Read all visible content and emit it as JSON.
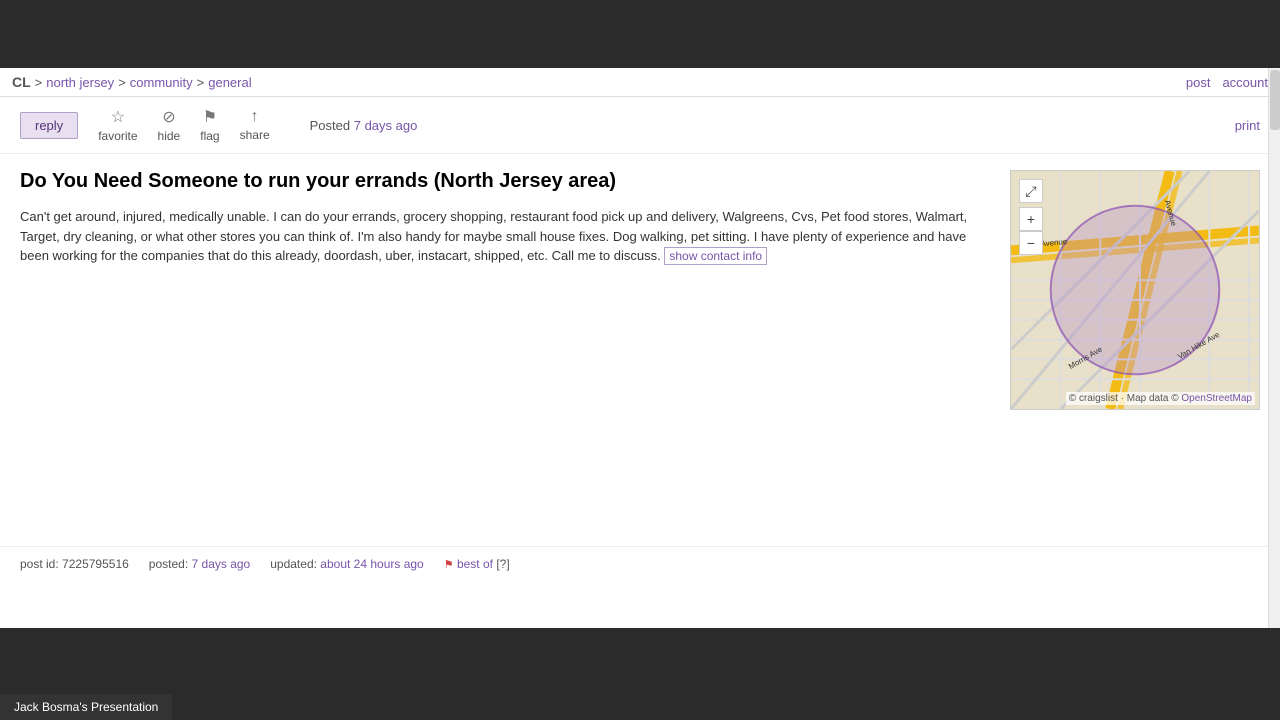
{
  "nav": {
    "cl_label": "CL",
    "breadcrumb_north_jersey": "north jersey",
    "breadcrumb_community": "community",
    "breadcrumb_general": "general",
    "separator": ">",
    "post_link": "post",
    "account_link": "account"
  },
  "toolbar": {
    "reply_label": "reply",
    "favorite_label": "favorite",
    "hide_label": "hide",
    "flag_label": "flag",
    "share_label": "share",
    "posted_label": "Posted",
    "posted_time": "7 days ago",
    "print_label": "print"
  },
  "post": {
    "title": "Do You Need Someone to run your errands (North Jersey area)",
    "body": "Can't get around, injured, medically unable. I can do your errands, grocery shopping, restaurant food pick up and delivery, Walgreens, Cvs, Pet food stores, Walmart, Target, dry cleaning, or what other stores you can think of. I'm also handy for maybe small house fixes. Dog walking, pet sitting. I have plenty of experience and have been working for the companies that do this already, doordash, uber, instacart, shipped, etc. Call me to discuss.",
    "contact_link": "show contact info"
  },
  "footer": {
    "post_id_label": "post id:",
    "post_id": "7225795516",
    "posted_label": "posted:",
    "posted_time": "7 days ago",
    "updated_label": "updated:",
    "updated_time": "about 24 hours ago",
    "best_of_label": "best of",
    "best_of_count": "[?]"
  },
  "map": {
    "attribution": "© craigslist · Map data ©",
    "osm_label": "OpenStreetMap",
    "zoom_in": "+",
    "zoom_out": "−",
    "fullscreen": "⤢"
  },
  "taskbar": {
    "label": "Jack Bosma's Presentation"
  }
}
